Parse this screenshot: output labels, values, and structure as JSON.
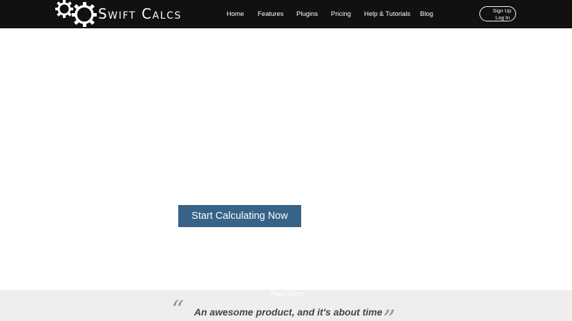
{
  "header": {
    "logo_text": "Swift Calcs",
    "nav": [
      {
        "label": "Home"
      },
      {
        "label": "Features"
      },
      {
        "label": "Plugins"
      },
      {
        "label": "Pricing"
      },
      {
        "label": "Help & Tutorials"
      },
      {
        "label": "Blog"
      }
    ],
    "signup_label": "Sign Up",
    "login_label": "Log In"
  },
  "hero": {
    "cta_label": "Start Calculating Now"
  },
  "testimonial": {
    "play_video_label": "Play Video",
    "open_quote": "“",
    "close_quote": "”",
    "quote": "An awesome product, and it's about time"
  },
  "colors": {
    "header_bg": "#111111",
    "cta_bg": "#366387",
    "band_bg": "#eeeeee"
  }
}
